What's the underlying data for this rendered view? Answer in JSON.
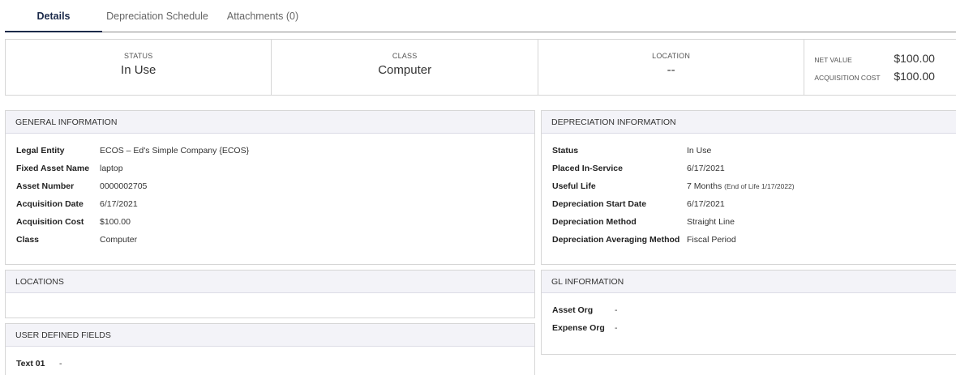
{
  "tabs": [
    {
      "label": "Details",
      "active": true
    },
    {
      "label": "Depreciation Schedule",
      "active": false
    },
    {
      "label": "Attachments (0)",
      "active": false
    }
  ],
  "summary": {
    "status_label": "STATUS",
    "status_value": "In Use",
    "class_label": "CLASS",
    "class_value": "Computer",
    "location_label": "LOCATION",
    "location_value": "--",
    "net_value_label": "NET VALUE",
    "net_value": "$100.00",
    "acq_cost_label": "ACQUISITION COST",
    "acq_cost": "$100.00"
  },
  "general": {
    "title": "GENERAL INFORMATION",
    "rows": [
      {
        "label": "Legal Entity",
        "value": "ECOS – Ed's Simple Company {ECOS}"
      },
      {
        "label": "Fixed Asset Name",
        "value": "laptop"
      },
      {
        "label": "Asset Number",
        "value": "0000002705"
      },
      {
        "label": "Acquisition Date",
        "value": "6/17/2021"
      },
      {
        "label": "Acquisition Cost",
        "value": "$100.00"
      },
      {
        "label": "Class",
        "value": "Computer"
      }
    ]
  },
  "depreciation": {
    "title": "DEPRECIATION INFORMATION",
    "rows": [
      {
        "label": "Status",
        "value": "In Use"
      },
      {
        "label": "Placed In-Service",
        "value": "6/17/2021"
      },
      {
        "label": "Useful Life",
        "value": "7 Months",
        "note": "(End of Life 1/17/2022)"
      },
      {
        "label": "Depreciation Start Date",
        "value": "6/17/2021"
      },
      {
        "label": "Depreciation Method",
        "value": "Straight Line"
      },
      {
        "label": "Depreciation Averaging Method",
        "value": "Fiscal Period"
      }
    ]
  },
  "locations": {
    "title": "LOCATIONS"
  },
  "gl": {
    "title": "GL INFORMATION",
    "rows": [
      {
        "label": "Asset Org",
        "value": "-"
      },
      {
        "label": "Expense Org",
        "value": "-"
      }
    ]
  },
  "udf": {
    "title": "USER DEFINED FIELDS",
    "rows": [
      {
        "label": "Text 01",
        "value": "-"
      }
    ]
  }
}
